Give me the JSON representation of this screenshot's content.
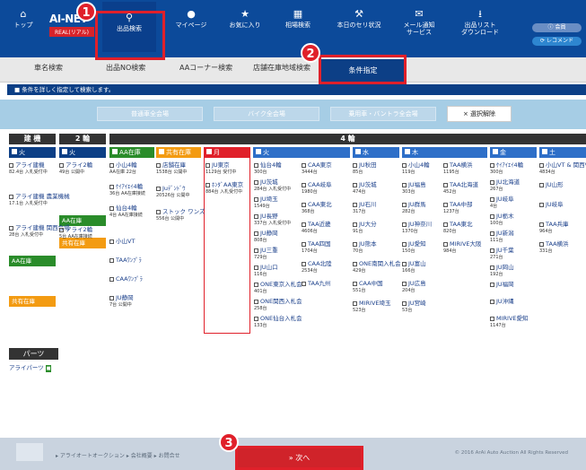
{
  "nav": {
    "logo_main": "AI-NET",
    "logo_sub": "REAL(リアル)",
    "items": [
      {
        "label": "トップ",
        "icon": "home-icon",
        "glyph": "⌂"
      },
      {
        "label": "出品検索",
        "icon": "search-icon",
        "glyph": "⚲"
      },
      {
        "label": "マイページ",
        "icon": "user-icon",
        "glyph": "●"
      },
      {
        "label": "お気に入り",
        "icon": "star-icon",
        "glyph": "★"
      },
      {
        "label": "相場検索",
        "icon": "chart-icon",
        "glyph": "▦"
      },
      {
        "label": "本日のセリ状況",
        "icon": "hammer-icon",
        "glyph": "⚒"
      },
      {
        "label": "メール通知\nサービス",
        "icon": "mail-icon",
        "glyph": "✉"
      },
      {
        "label": "出品リスト\nダウンロード",
        "icon": "download-icon",
        "glyph": "⭳"
      }
    ],
    "pill_top": "ⓘ 会員",
    "pill_bottom": "⟳ レコメンド"
  },
  "tabs": [
    "車名検索",
    "出品NO検索",
    "AAコーナー検索",
    "店舗在庫地域検索",
    "条件指定"
  ],
  "info_bar": "■ 条件を詳しく指定して検索します。",
  "filters": {
    "b1": "普通車全会場",
    "b2": "バイク全会場",
    "b3": "乗用車・バントラ全会場",
    "clear": "× 選択解除"
  },
  "columns": {
    "build": "建 機",
    "two": "2 輪",
    "four": "4 輪"
  },
  "days": [
    "火",
    "火",
    "月",
    "火",
    "水",
    "木",
    "金",
    "土"
  ],
  "subs": {
    "aa1": "AA在庫",
    "kyo1": "共有在庫",
    "aa2": "AA在庫",
    "kyo2": "共有在庫",
    "aa3": "AA在庫",
    "kyo3": "共有在庫"
  },
  "build": [
    {
      "name": "アライ建機",
      "sm": "82.4台 入札受付中"
    },
    {
      "name": "アライ建機 農業機械",
      "sm": "17.1台 入札受付中"
    },
    {
      "name": "アライ建機 関西会場",
      "sm": "28台 入札受付中"
    }
  ],
  "two": [
    {
      "name": "アライ2輪",
      "sm": "49台 公開中"
    },
    {
      "name": "アライ2輪",
      "sm": "5台 AA在庫接続"
    }
  ],
  "aa": [
    {
      "name": "小山4輪",
      "sm": "AA在庫 22台"
    },
    {
      "name": "ｹｲｱｲｴｲ4輪",
      "sm": "36台 AA在庫接続"
    },
    {
      "name": "仙台4輪",
      "sm": "4台 AA在庫接続"
    },
    {
      "name": "小山VT",
      "sm": ""
    },
    {
      "name": "TAAﾜﾝﾌﾟﾗ",
      "sm": ""
    },
    {
      "name": "CAAﾜﾝﾌﾟﾗ",
      "sm": ""
    },
    {
      "name": "JU静岡",
      "sm": "7台 公開中"
    }
  ],
  "kyo": [
    {
      "name": "店舗在庫",
      "sm": "1538台 公開中"
    },
    {
      "name": "Juﾃﾞﾝﾄﾞｳ",
      "sm": "20526台 公開中"
    },
    {
      "name": "ストック ワンズ",
      "sm": "556台 公開中"
    }
  ],
  "mon": [
    {
      "name": "JU東京",
      "sm": "1129台 受付中"
    },
    {
      "name": "ﾎﾝﾀﾞAA東京",
      "sm": "884台 入札受付中"
    }
  ],
  "tue": [
    {
      "name": "仙台4輪",
      "sm": "300台"
    },
    {
      "name": "JU茨城",
      "sm": "284台 入札受付中"
    },
    {
      "name": "JU埼玉",
      "sm": "1549台"
    },
    {
      "name": "JU長野",
      "sm": "337台 入札受付中"
    },
    {
      "name": "JU静岡",
      "sm": "808台"
    },
    {
      "name": "JU三重",
      "sm": "729台"
    },
    {
      "name": "JU山口",
      "sm": "116台"
    },
    {
      "name": "ONE東京入札会",
      "sm": "401台"
    },
    {
      "name": "ONE関西入札会",
      "sm": "258台"
    },
    {
      "name": "ONE仙台入札会",
      "sm": "133台"
    }
  ],
  "tue2": [
    {
      "name": "CAA東京",
      "sm": "3444台"
    },
    {
      "name": "CAA岐阜",
      "sm": "1980台"
    },
    {
      "name": "CAA東北",
      "sm": "368台"
    },
    {
      "name": "TAA近畿",
      "sm": "4606台"
    },
    {
      "name": "TAA四国",
      "sm": "1704台"
    },
    {
      "name": "CAA北陸",
      "sm": "2534台"
    },
    {
      "name": "TAA九州",
      "sm": ""
    }
  ],
  "wed": [
    {
      "name": "JU秋田",
      "sm": "85台"
    },
    {
      "name": "JU茨城",
      "sm": "474台"
    },
    {
      "name": "JU石川",
      "sm": "317台"
    },
    {
      "name": "JU大分",
      "sm": "91台"
    },
    {
      "name": "JU熊本",
      "sm": "70台"
    },
    {
      "name": "ONE南関入札会",
      "sm": "429台"
    },
    {
      "name": "CAA中国",
      "sm": "551台"
    },
    {
      "name": "MIRIVE埼玉",
      "sm": "523台"
    }
  ],
  "thu": [
    {
      "name": "小山4輪",
      "sm": "119台"
    },
    {
      "name": "JU福島",
      "sm": "303台"
    },
    {
      "name": "JU群馬",
      "sm": "282台"
    },
    {
      "name": "JU神奈川",
      "sm": "1370台"
    },
    {
      "name": "JU愛知",
      "sm": "150台"
    },
    {
      "name": "JU富山",
      "sm": "166台"
    },
    {
      "name": "JU広島",
      "sm": "204台"
    },
    {
      "name": "JU宮崎",
      "sm": "53台"
    }
  ],
  "thu2": [
    {
      "name": "TAA横浜",
      "sm": "1195台"
    },
    {
      "name": "TAA北海道",
      "sm": "452台"
    },
    {
      "name": "TAA中部",
      "sm": "1237台"
    },
    {
      "name": "TAA東北",
      "sm": "820台"
    },
    {
      "name": "MIRIVE大阪",
      "sm": "984台"
    }
  ],
  "fri": [
    {
      "name": "ｹｲｱｲｴｲ4輪",
      "sm": "300台"
    },
    {
      "name": "JU北海道",
      "sm": "267台"
    },
    {
      "name": "JU岐阜",
      "sm": "4台"
    },
    {
      "name": "JU栃木",
      "sm": "100台"
    },
    {
      "name": "JU新潟",
      "sm": "111台"
    },
    {
      "name": "JU千葉",
      "sm": "271台"
    },
    {
      "name": "JU岡山",
      "sm": "192台"
    },
    {
      "name": "JU福岡",
      "sm": ""
    },
    {
      "name": "JU沖縄",
      "sm": ""
    },
    {
      "name": "MIRIVE愛知",
      "sm": "1147台"
    }
  ],
  "sat": [
    {
      "name": "小山VT & 関西VT",
      "sm": "4834台"
    },
    {
      "name": "JU山形",
      "sm": ""
    },
    {
      "name": "JU岐阜",
      "sm": ""
    },
    {
      "name": "TAA兵庫",
      "sm": "964台"
    },
    {
      "name": "TAA横浜",
      "sm": "331台"
    }
  ],
  "parts": {
    "title": "パーツ",
    "item": "アライパーツ"
  },
  "footer": {
    "crumbs": "▸ アライオートオークション   ▸ 会社概要   ▸ お問合せ",
    "copy": "© 2016 ArAi Auto Auction All Rights Reserved"
  },
  "next_label": "» 次へ",
  "markers": [
    "1",
    "2",
    "3"
  ],
  "colors": {
    "nav": "#0c4a9a",
    "dark": "#0c3f86",
    "green": "#2a8c2a",
    "orange": "#f39b12",
    "red": "#e0202a",
    "blue": "#2e6fc8"
  }
}
